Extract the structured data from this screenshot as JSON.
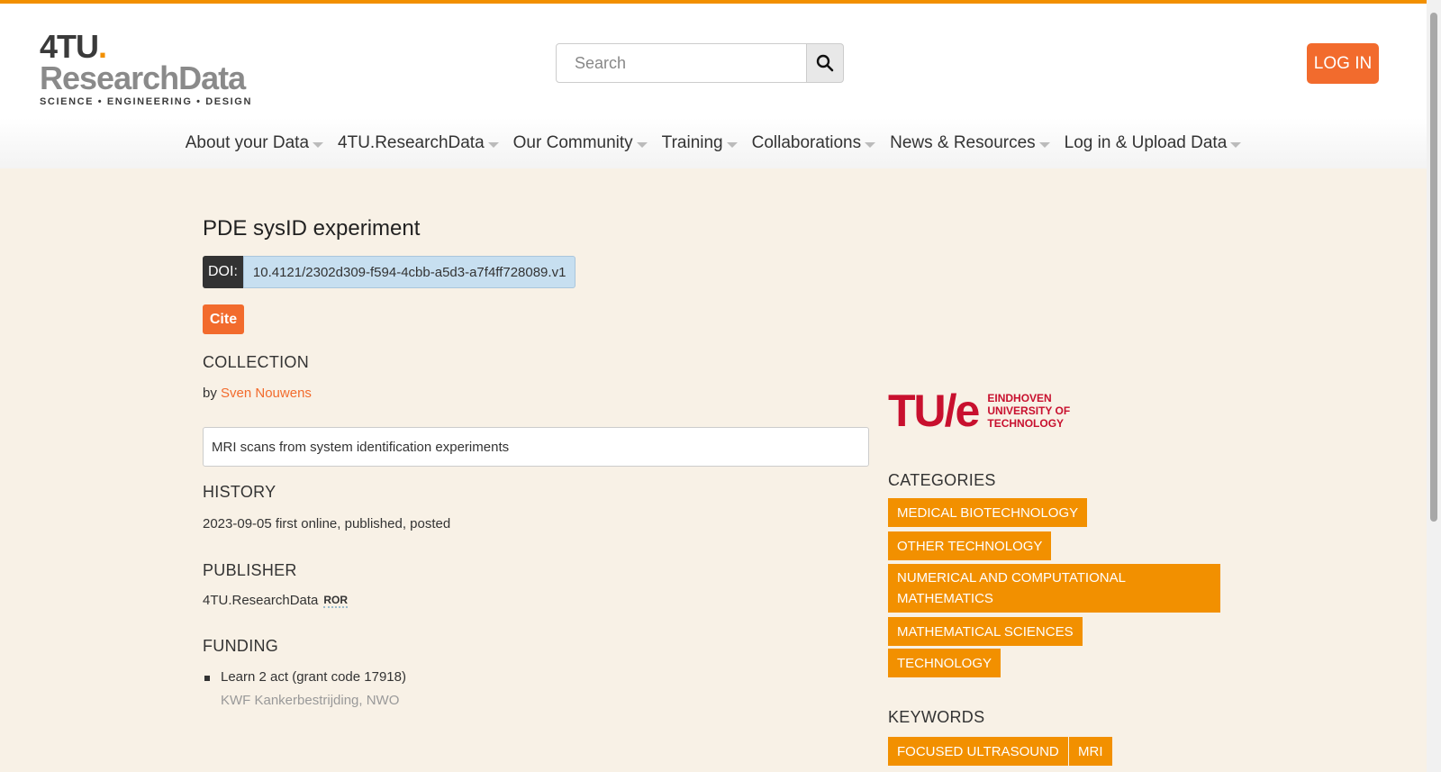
{
  "header": {
    "logo": {
      "line1": "4TU",
      "dot": ".",
      "line2": "ResearchData",
      "tagline": "SCIENCE • ENGINEERING • DESIGN"
    },
    "search": {
      "placeholder": "Search"
    },
    "login_label": "LOG IN"
  },
  "nav": {
    "items": [
      {
        "label": "About your Data"
      },
      {
        "label": "4TU.ResearchData"
      },
      {
        "label": "Our Community"
      },
      {
        "label": "Training"
      },
      {
        "label": "Collaborations"
      },
      {
        "label": "News & Resources"
      },
      {
        "label": "Log in & Upload Data"
      }
    ]
  },
  "dataset": {
    "title": "PDE sysID experiment",
    "doi_label": "DOI:",
    "doi_value": "10.4121/2302d309-f594-4cbb-a5d3-a7f4ff728089.v1",
    "cite_label": "Cite",
    "collection_heading": "COLLECTION",
    "by_prefix": "by",
    "author": "Sven Nouwens",
    "description": "MRI scans from system identification experiments",
    "history_heading": "HISTORY",
    "history_text": "2023-09-05 first online, published, posted",
    "publisher_heading": "PUBLISHER",
    "publisher": "4TU.ResearchData",
    "ror_label": "ROR",
    "funding_heading": "FUNDING",
    "funding_item": "Learn 2 act (grant code 17918)",
    "funding_funders": "KWF Kankerbestrijding, NWO"
  },
  "sidebar": {
    "institution": {
      "logo_text": "TU/e",
      "line1": "EINDHOVEN",
      "line2": "UNIVERSITY OF",
      "line3": "TECHNOLOGY"
    },
    "categories_heading": "CATEGORIES",
    "categories": [
      "MEDICAL BIOTECHNOLOGY",
      "OTHER TECHNOLOGY",
      "NUMERICAL AND COMPUTATIONAL MATHEMATICS",
      "MATHEMATICAL SCIENCES",
      "TECHNOLOGY"
    ],
    "keywords_heading": "KEYWORDS",
    "keywords": [
      "FOCUSED ULTRASOUND",
      "MRI"
    ]
  },
  "colors": {
    "accent": "#f26b2d",
    "tag": "#f29000",
    "background": "#f8f1e6",
    "tue_red": "#c8102e"
  },
  "icons": {
    "search": "search-icon",
    "caret": "caret-down-icon"
  }
}
